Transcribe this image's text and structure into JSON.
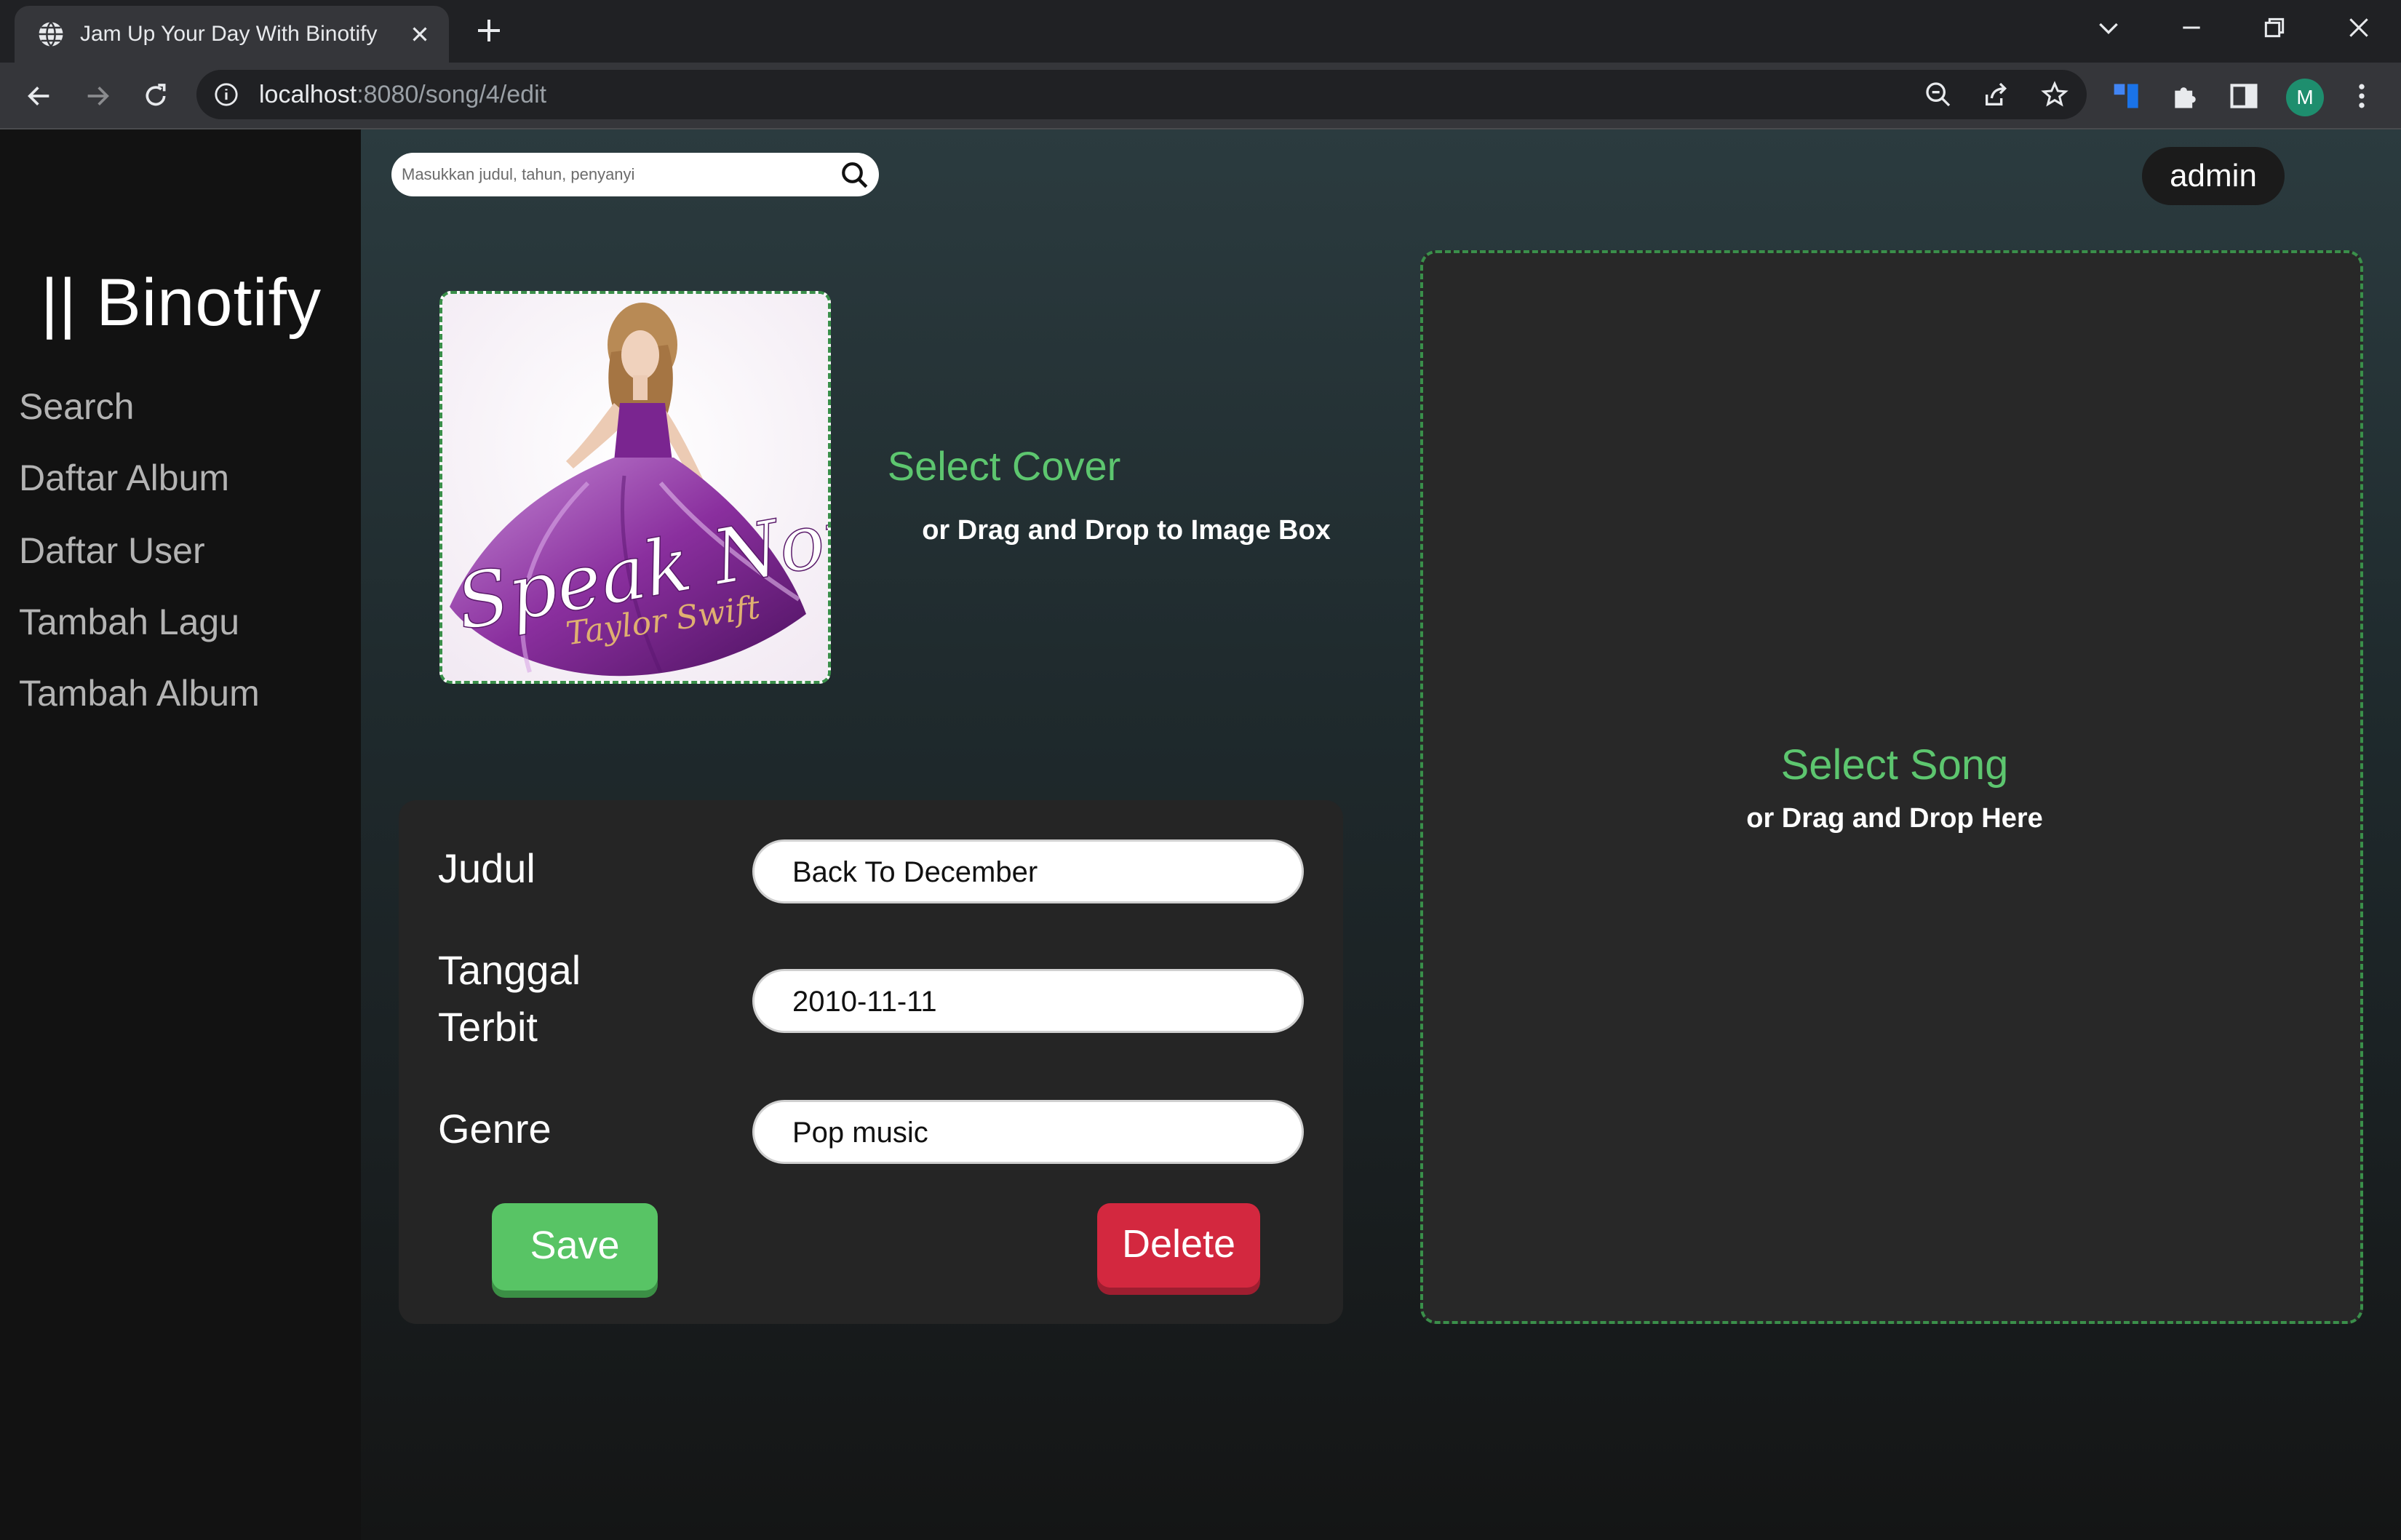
{
  "browser": {
    "tab_title": "Jam Up Your Day With Binotify",
    "url_host": "localhost",
    "url_path": ":8080/song/4/edit",
    "profile_initial": "M"
  },
  "sidebar": {
    "logo": "|| Binotify",
    "items": [
      {
        "label": "Search"
      },
      {
        "label": "Daftar Album"
      },
      {
        "label": "Daftar User"
      },
      {
        "label": "Tambah Lagu"
      },
      {
        "label": "Tambah Album"
      }
    ]
  },
  "header": {
    "search_placeholder": "Masukkan judul, tahun, penyanyi",
    "user_label": "admin"
  },
  "cover": {
    "select_label": "Select Cover",
    "hint": "or Drag and Drop to Image Box",
    "image_text": "Speak Now",
    "image_subtext": "Taylor Swift"
  },
  "form": {
    "title_label": "Judul",
    "title_value": "Back To December",
    "date_label_1": "Tanggal",
    "date_label_2": "Terbit",
    "date_value": "2010-11-11",
    "genre_label": "Genre",
    "genre_value": "Pop music",
    "save_label": "Save",
    "delete_label": "Delete"
  },
  "song": {
    "select_label": "Select Song",
    "hint": "or Drag and Drop Here"
  },
  "colors": {
    "accent_green": "#5dc66f",
    "save_green": "#58c465",
    "delete_red": "#d3283f"
  }
}
